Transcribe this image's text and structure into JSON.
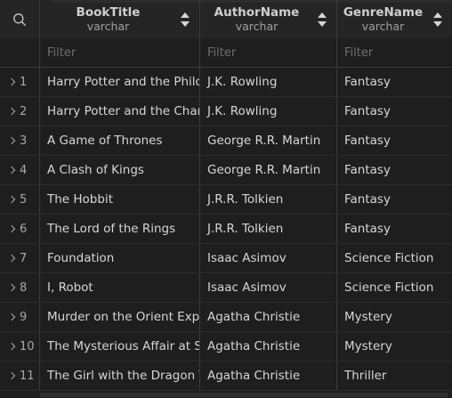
{
  "columns": [
    {
      "title": "BookTitle",
      "type": "varchar"
    },
    {
      "title": "AuthorName",
      "type": "varchar"
    },
    {
      "title": "GenreName",
      "type": "varchar"
    }
  ],
  "filter_placeholder": "Filter",
  "rows": [
    {
      "num": "1",
      "title": "Harry Potter and the Philosop",
      "author": "J.K. Rowling",
      "genre": "Fantasy"
    },
    {
      "num": "2",
      "title": "Harry Potter and the Chambe",
      "author": "J.K. Rowling",
      "genre": "Fantasy"
    },
    {
      "num": "3",
      "title": "A Game of Thrones",
      "author": "George R.R. Martin",
      "genre": "Fantasy"
    },
    {
      "num": "4",
      "title": "A Clash of Kings",
      "author": "George R.R. Martin",
      "genre": "Fantasy"
    },
    {
      "num": "5",
      "title": "The Hobbit",
      "author": "J.R.R. Tolkien",
      "genre": "Fantasy"
    },
    {
      "num": "6",
      "title": "The Lord of the Rings",
      "author": "J.R.R. Tolkien",
      "genre": "Fantasy"
    },
    {
      "num": "7",
      "title": "Foundation",
      "author": "Isaac Asimov",
      "genre": "Science Fiction"
    },
    {
      "num": "8",
      "title": "I, Robot",
      "author": "Isaac Asimov",
      "genre": "Science Fiction"
    },
    {
      "num": "9",
      "title": "Murder on the Orient Expre",
      "author": "Agatha Christie",
      "genre": "Mystery"
    },
    {
      "num": "10",
      "title": "The Mysterious Affair at Sty",
      "author": "Agatha Christie",
      "genre": "Mystery"
    },
    {
      "num": "11",
      "title": "The Girl with the Dragon Tat",
      "author": "Agatha Christie",
      "genre": "Thriller"
    }
  ],
  "icons": {
    "search": "search-icon",
    "sort": "sort-icon",
    "expand": "chevron-right-icon"
  },
  "colors": {
    "background": "#1e1e1e",
    "header": "#252526",
    "border": "#3a3a3a",
    "text": "#d6d6d6",
    "muted": "#6f6f6f"
  }
}
